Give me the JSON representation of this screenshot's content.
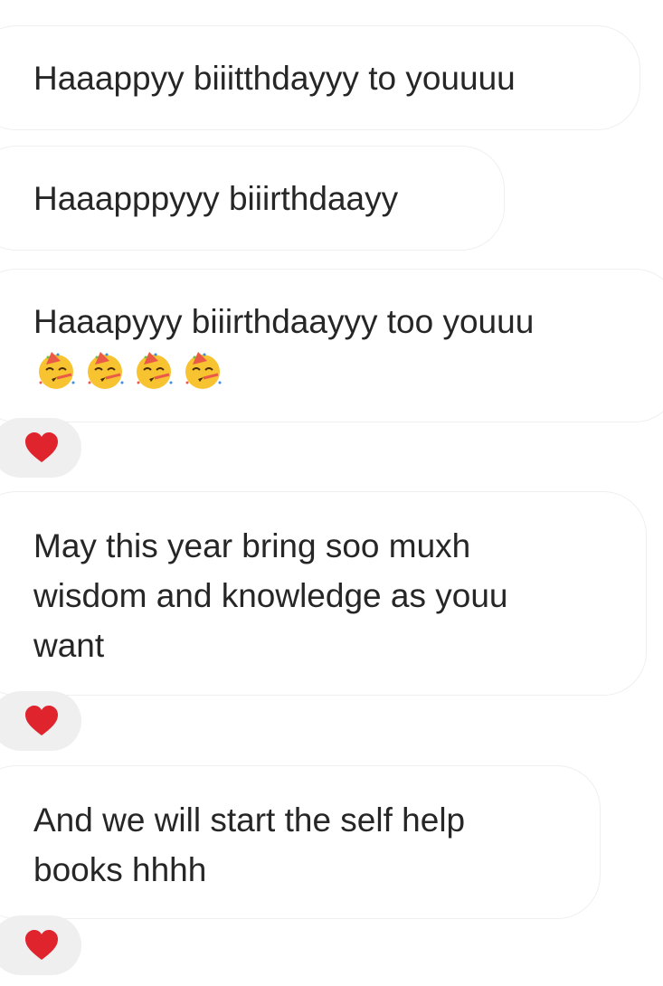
{
  "messages": [
    {
      "text": "Haaappyy biiitthdayyy to youuuu"
    },
    {
      "text": "Haaapppyyy biiirthdaayy"
    },
    {
      "text": "Haaapyyy biiirthdaayyy too youuu",
      "emojis": [
        "partying-face-icon",
        "partying-face-icon",
        "partying-face-icon",
        "partying-face-icon"
      ]
    },
    {
      "text": "May this year bring soo muxh\nwisdom and knowledge as youu\nwant"
    },
    {
      "text": "And we will start the self help\nbooks hhhh"
    }
  ],
  "reactions": [
    {
      "icon": "red-heart-icon",
      "color": "#e0242e"
    },
    {
      "icon": "red-heart-icon",
      "color": "#e0242e"
    },
    {
      "icon": "red-heart-icon",
      "color": "#e0242e"
    }
  ],
  "colors": {
    "bubble_border": "#efefef",
    "reaction_bg": "#efefef",
    "text": "#262626"
  }
}
